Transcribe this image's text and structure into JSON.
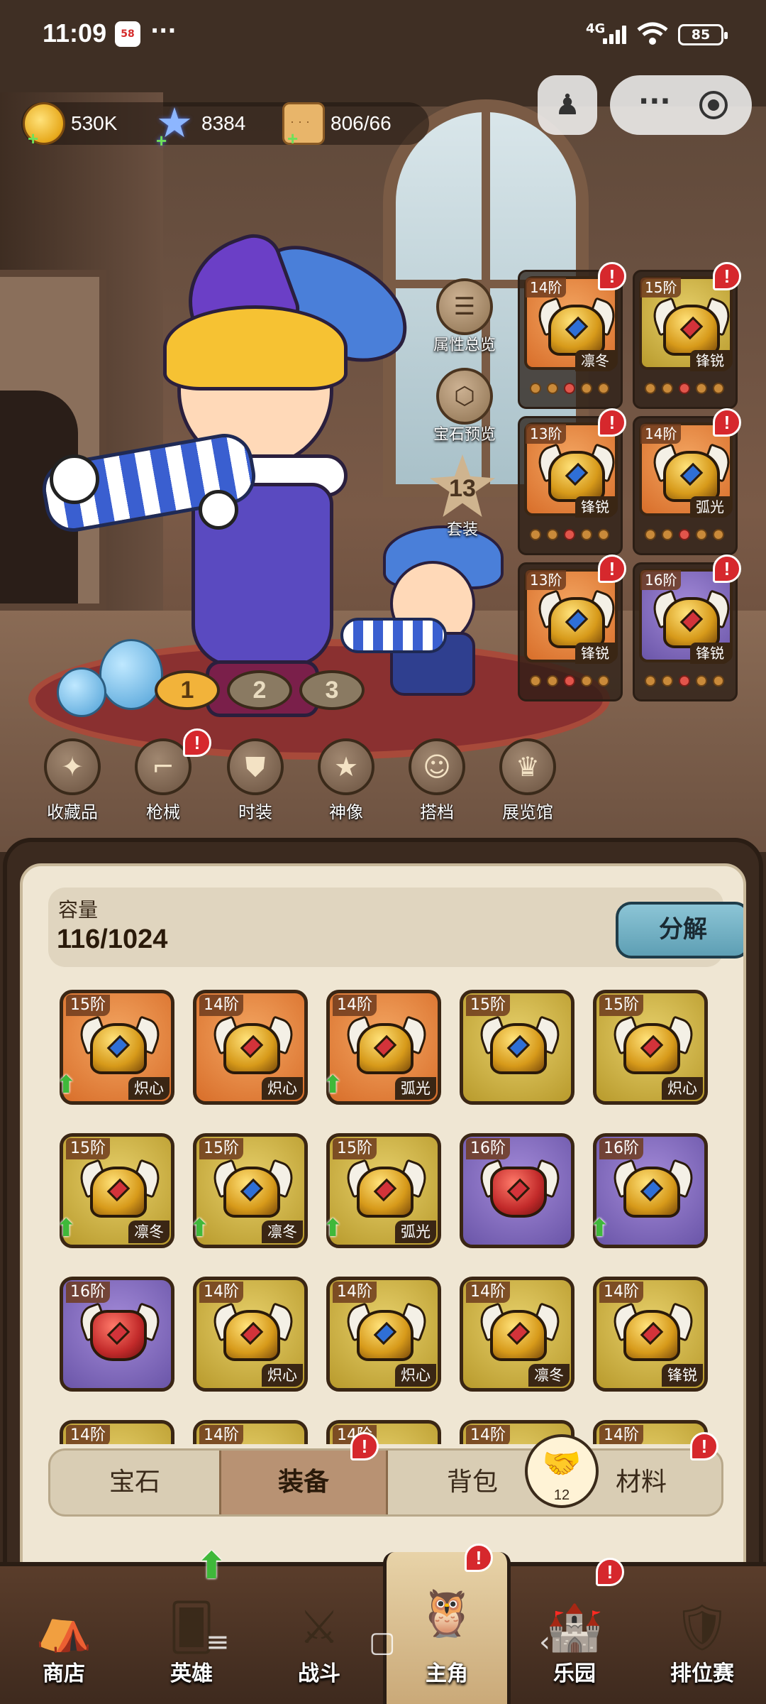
{
  "status_bar": {
    "time": "11:09",
    "app_badge": "58",
    "more_dots": "···",
    "network": "4G",
    "battery": "85"
  },
  "currency": {
    "coins": "530K",
    "stars": "8384",
    "stamina": "806/66"
  },
  "side_actions": {
    "attr_overview": "属性总览",
    "gem_preview": "宝石预览",
    "set_count": "13",
    "set_label": "套装"
  },
  "equip_slots": [
    {
      "tier": "14阶",
      "plus": "+",
      "tag": "凛冬",
      "bg": "bg-orange",
      "gem": "blue"
    },
    {
      "tier": "15阶",
      "plus": "+",
      "tag": "锋锐",
      "bg": "bg-gold",
      "gem": "red"
    },
    {
      "tier": "13阶",
      "plus": "+",
      "tag": "锋锐",
      "bg": "bg-orange",
      "gem": "blue"
    },
    {
      "tier": "14阶",
      "plus": "+",
      "tag": "弧光",
      "bg": "bg-orange",
      "gem": "blue"
    },
    {
      "tier": "13阶",
      "plus": "+",
      "tag": "锋锐",
      "bg": "bg-orange",
      "gem": "blue"
    },
    {
      "tier": "16阶",
      "plus": "+",
      "tag": "锋锐",
      "bg": "bg-purple",
      "gem": "red"
    }
  ],
  "loadout_pages": [
    "1",
    "2",
    "3"
  ],
  "feature_buttons": [
    {
      "label": "收藏品",
      "icon": "collection-icon"
    },
    {
      "label": "枪械",
      "icon": "gun-icon"
    },
    {
      "label": "时装",
      "icon": "costume-icon"
    },
    {
      "label": "神像",
      "icon": "statue-icon"
    },
    {
      "label": "搭档",
      "icon": "partner-icon"
    },
    {
      "label": "展览馆",
      "icon": "gallery-icon"
    }
  ],
  "inventory": {
    "capacity_label": "容量",
    "capacity_value": "116/1024",
    "decompose_label": "分解",
    "items": [
      {
        "tier": "15阶",
        "tag": "炽心",
        "bg": "bg-orange",
        "up": true
      },
      {
        "tier": "14阶",
        "tag": "炽心",
        "bg": "bg-orange",
        "up": false
      },
      {
        "tier": "14阶",
        "tag": "弧光",
        "bg": "bg-orange",
        "up": true
      },
      {
        "tier": "15阶",
        "tag": "",
        "bg": "bg-gold",
        "up": false
      },
      {
        "tier": "15阶",
        "tag": "炽心",
        "bg": "bg-gold",
        "up": false
      },
      {
        "tier": "15阶",
        "tag": "凛冬",
        "bg": "bg-gold",
        "up": true
      },
      {
        "tier": "15阶",
        "tag": "凛冬",
        "bg": "bg-gold",
        "up": true
      },
      {
        "tier": "15阶",
        "tag": "弧光",
        "bg": "bg-gold",
        "up": true
      },
      {
        "tier": "16阶",
        "tag": "",
        "bg": "bg-purple",
        "up": false
      },
      {
        "tier": "16阶",
        "tag": "",
        "bg": "bg-purple",
        "up": true
      },
      {
        "tier": "16阶",
        "tag": "",
        "bg": "bg-purple",
        "up": false
      },
      {
        "tier": "14阶",
        "tag": "炽心",
        "bg": "bg-gold",
        "up": false
      },
      {
        "tier": "14阶",
        "tag": "炽心",
        "bg": "bg-gold",
        "up": false
      },
      {
        "tier": "14阶",
        "tag": "凛冬",
        "bg": "bg-gold",
        "up": false
      },
      {
        "tier": "14阶",
        "tag": "锋锐",
        "bg": "bg-gold",
        "up": false
      },
      {
        "tier": "14阶",
        "tag": "",
        "bg": "bg-gold",
        "up": false
      },
      {
        "tier": "14阶",
        "tag": "",
        "bg": "bg-gold",
        "up": false
      },
      {
        "tier": "14阶",
        "tag": "",
        "bg": "bg-gold",
        "up": false
      },
      {
        "tier": "14阶",
        "tag": "",
        "bg": "bg-gold",
        "up": false
      },
      {
        "tier": "14阶",
        "tag": "",
        "bg": "bg-gold",
        "up": false
      }
    ],
    "tabs": [
      "宝石",
      "装备",
      "背包",
      "材料"
    ],
    "active_tab": "装备",
    "handshake_count": "12"
  },
  "bottom_nav": [
    {
      "label": "商店",
      "icon": "shop-icon"
    },
    {
      "label": "英雄",
      "icon": "hero-cards-icon"
    },
    {
      "label": "战斗",
      "icon": "battle-icon"
    },
    {
      "label": "主角",
      "icon": "owl-icon"
    },
    {
      "label": "乐园",
      "icon": "castle-icon"
    },
    {
      "label": "排位赛",
      "icon": "ranked-icon"
    }
  ],
  "alert_mark": "!",
  "colors": {
    "accent_blue": "#6aa9bd",
    "alert_red": "#d6282d",
    "upgrade_green": "#3fb83a"
  }
}
